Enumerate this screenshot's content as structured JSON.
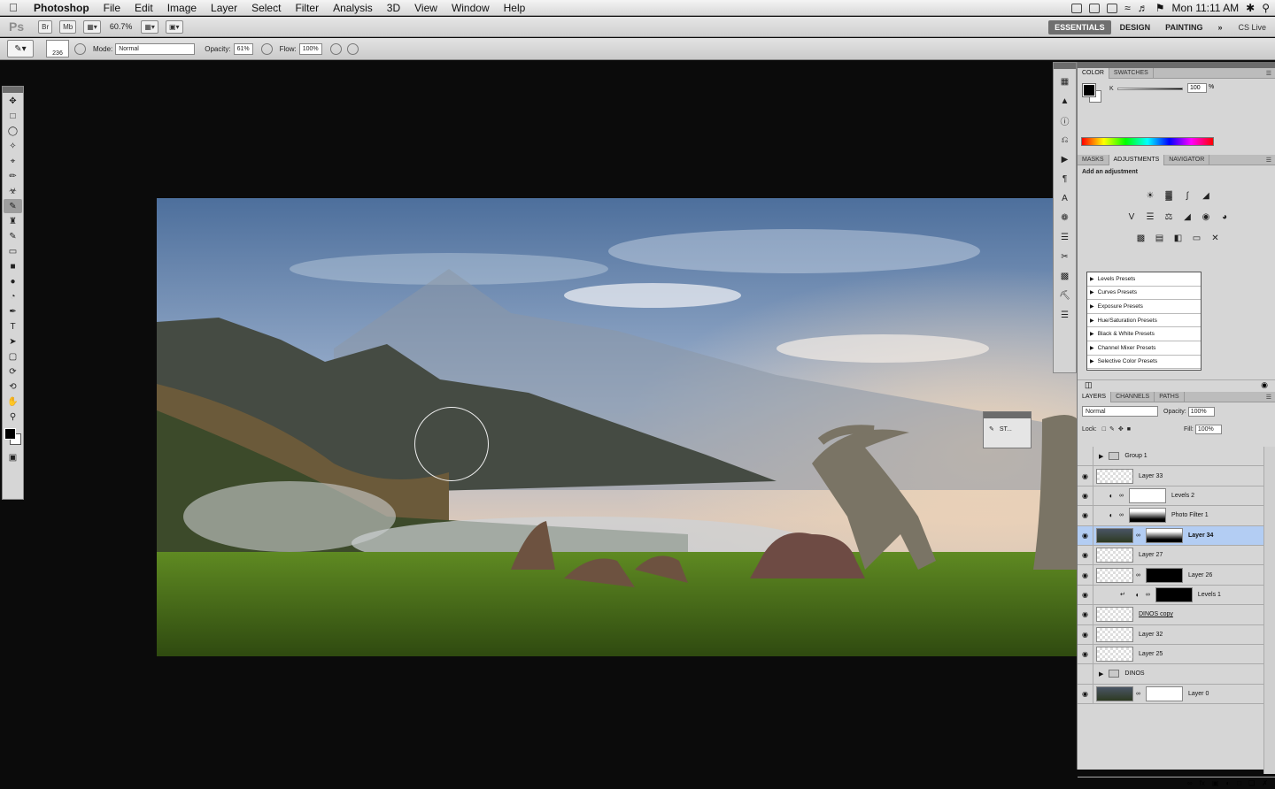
{
  "menubar": {
    "app": "Photoshop",
    "items": [
      "File",
      "Edit",
      "Image",
      "Layer",
      "Select",
      "Filter",
      "Analysis",
      "3D",
      "View",
      "Window",
      "Help"
    ],
    "clock": "Mon 11:11 AM"
  },
  "appbar": {
    "logo": "Ps",
    "bridge_label": "Br",
    "mini_bridge_label": "Mb",
    "zoom": "60.7%",
    "workspaces": [
      "ESSENTIALS",
      "DESIGN",
      "PAINTING"
    ],
    "more": "»",
    "cslive": "CS Live"
  },
  "options": {
    "brush_size": "236",
    "mode_label": "Mode:",
    "mode_value": "Normal",
    "opacity_label": "Opacity:",
    "opacity_value": "61%",
    "flow_label": "Flow:",
    "flow_value": "100%"
  },
  "float_panel": {
    "label": "ST..."
  },
  "color_panel": {
    "tabs": [
      "COLOR",
      "SWATCHES"
    ],
    "channel": "K",
    "value": "100",
    "unit": "%",
    "fg_color": "#000000",
    "bg_color": "#ffffff"
  },
  "adjust_panel": {
    "tabs": [
      "MASKS",
      "ADJUSTMENTS",
      "NAVIGATOR"
    ],
    "title": "Add an adjustment",
    "presets": [
      "Levels Presets",
      "Curves Presets",
      "Exposure Presets",
      "Hue/Saturation Presets",
      "Black & White Presets",
      "Channel Mixer Presets",
      "Selective Color Presets"
    ]
  },
  "layers_panel": {
    "tabs": [
      "LAYERS",
      "CHANNELS",
      "PATHS"
    ],
    "blend": "Normal",
    "opacity_label": "Opacity:",
    "opacity": "100%",
    "lock_label": "Lock:",
    "fill_label": "Fill:",
    "fill": "100%",
    "layers": [
      {
        "name": "Group 1",
        "kind": "group",
        "visible": false
      },
      {
        "name": "Layer 33",
        "kind": "pixel",
        "visible": true
      },
      {
        "name": "Levels 2",
        "kind": "adjust",
        "visible": true
      },
      {
        "name": "Photo Filter 1",
        "kind": "adjust",
        "visible": true
      },
      {
        "name": "Layer 34",
        "kind": "masked",
        "visible": true,
        "selected": true
      },
      {
        "name": "Layer 27",
        "kind": "pixel",
        "visible": true
      },
      {
        "name": "Layer 26",
        "kind": "masked",
        "visible": true
      },
      {
        "name": "Levels 1",
        "kind": "adjust",
        "visible": true
      },
      {
        "name": "DINOS copy",
        "kind": "pixel",
        "visible": true
      },
      {
        "name": "Layer 32",
        "kind": "pixel",
        "visible": true
      },
      {
        "name": "Layer 25",
        "kind": "pixel",
        "visible": true
      },
      {
        "name": "DINOS",
        "kind": "group",
        "visible": false
      },
      {
        "name": "Layer 0",
        "kind": "masked",
        "visible": true
      }
    ]
  }
}
